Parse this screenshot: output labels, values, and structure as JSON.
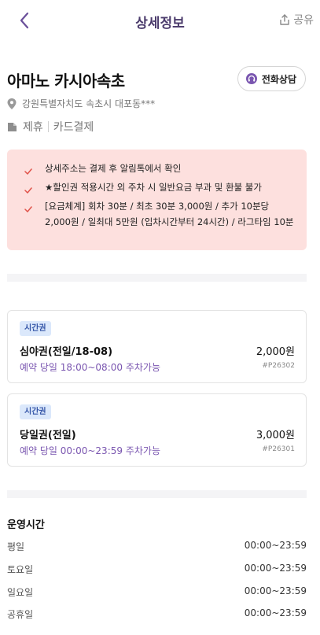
{
  "header": {
    "title": "상세정보",
    "share_label": "공유"
  },
  "place": {
    "name": "아마노 카시아속초",
    "call_label": "전화상담",
    "address": "강원특별자치도 속초시 대포동***",
    "tags": [
      "제휴",
      "카드결제"
    ]
  },
  "notice": {
    "items": [
      "상세주소는 결제 후 알림톡에서 확인",
      "★할인권 적용시간 외 주차 시 일반요금 부과 및 환불 불가",
      "[요금체계] 회차 30분 / 최초 30분 3,000원 / 추가 10분당 2,000원 / 일최대 5만원 (입차시간부터 24시간) / 라그타임 10분"
    ]
  },
  "tickets": [
    {
      "badge": "시간권",
      "name": "심야권(전일/18-08)",
      "price": "2,000원",
      "availability": "예약 당일 18:00~08:00 주차가능",
      "code": "#P26302"
    },
    {
      "badge": "시간권",
      "name": "당일권(전일)",
      "price": "3,000원",
      "availability": "예약 당일 00:00~23:59 주차가능",
      "code": "#P26301"
    }
  ],
  "hours": {
    "title": "운영시간",
    "rows": [
      {
        "day": "평일",
        "time": "00:00~23:59"
      },
      {
        "day": "토요일",
        "time": "00:00~23:59"
      },
      {
        "day": "일요일",
        "time": "00:00~23:59"
      },
      {
        "day": "공휴일",
        "time": "00:00~23:59"
      }
    ]
  },
  "colors": {
    "accent": "#7a56b0",
    "notice_bg": "#fde0de",
    "check": "#e0534a",
    "badge_bg": "#dbe8fb"
  },
  "icons": {
    "back": "chevron-left-icon",
    "share": "share-icon",
    "call": "headset-icon",
    "address": "location-pin-icon",
    "tag": "tag-icon",
    "check": "check-icon"
  }
}
